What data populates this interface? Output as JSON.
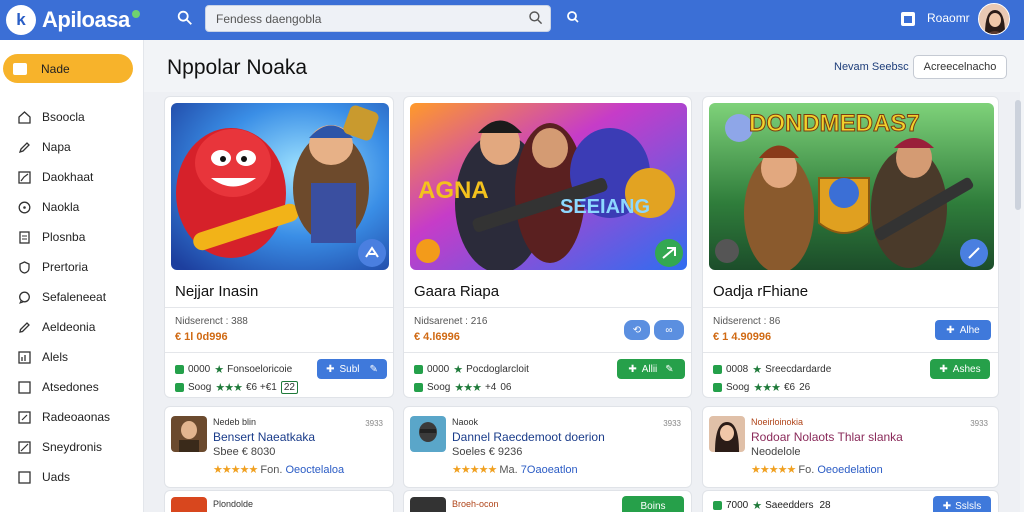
{
  "header": {
    "app_name": "Apiloasa",
    "search_placeholder": "Fendess daengobla",
    "user_name": "Roaomr"
  },
  "sidebar": {
    "active": "Nade",
    "items": [
      "Bsoocla",
      "Napa",
      "Daokhaat",
      "Naokla",
      "Plosnba",
      "Prertoria",
      "Sefaleneeat",
      "Aeldeonia",
      "Alels",
      "Atsedones",
      "Radeoaonas",
      "Sneydronis",
      "Uads"
    ]
  },
  "main": {
    "title": "Nppolar Noaka",
    "newest_link": "Nevam Seebsc",
    "filter_button": "Acreecelnacho"
  },
  "cards": [
    {
      "title": "Nejjar Inasin",
      "subtitle": "Nidserenct : 388",
      "price": "€ 1l 0d996",
      "row1_count": "0000",
      "row1_text": "Fonsoeloricoie",
      "row2_count": "Soog",
      "row2_extra": "€6 +€1",
      "row2_badge": "22",
      "button": "Subl",
      "badge_color": "#4a7fe0",
      "art_theme": "blue"
    },
    {
      "title": "Gaara Riapa",
      "subtitle": "Nidsarenet : 216",
      "price": "€ 4.l6996",
      "row1_count": "0000",
      "row1_text": "Pocdoglarcloit",
      "row2_count": "Soog",
      "row2_extra": "+4",
      "row2_badge": "06",
      "button": "Allii",
      "badge_color": "#33a852",
      "art_theme": "purple"
    },
    {
      "title": "Oadja rFhiane",
      "subtitle": "Nidserenct : 86",
      "price": "€ 1 4.90996",
      "row1_count": "0008",
      "row1_text": "Sreecdardarde",
      "row2_count": "Soog",
      "row2_extra": "€6",
      "row2_badge": "26",
      "button": "Ashes",
      "top_button": "Alhe",
      "badge_color": "#4a7fe0",
      "art_theme": "green"
    }
  ],
  "small_cards": [
    {
      "label": "Nedeb blin",
      "time": "3933",
      "name": "Bensert  Naeatkaka",
      "line2": "Sbee  € 8030",
      "rating_text": "Fon.",
      "category": "Oeoctelaloa"
    },
    {
      "label": "Naook",
      "time": "3933",
      "name": "Dannel Raecdemoot doerion",
      "line2": "Soeles  € 9236",
      "rating_text": "Ma.",
      "category": "7Oaoeatlon"
    },
    {
      "label": "Noeirloinokia",
      "time": "3933",
      "name": "Rodoar  Nolaots  Thlar slanka",
      "line2": "Neodelole",
      "rating_text": "Fo.",
      "category": "Oeoedelation"
    }
  ],
  "bottom_row": {
    "left_label": "Plondolde",
    "mid_label": "Broeh-ocon",
    "mid_button": "Boins",
    "right_count": "7000",
    "right_text": "Saeedders",
    "right_badge": "28",
    "right_button": "Sslsls"
  },
  "colors": {
    "header_bg": "#3b6fd6",
    "active_nav": "#f7b32b",
    "primary_button": "#3f79db",
    "success_button": "#26a04a"
  }
}
